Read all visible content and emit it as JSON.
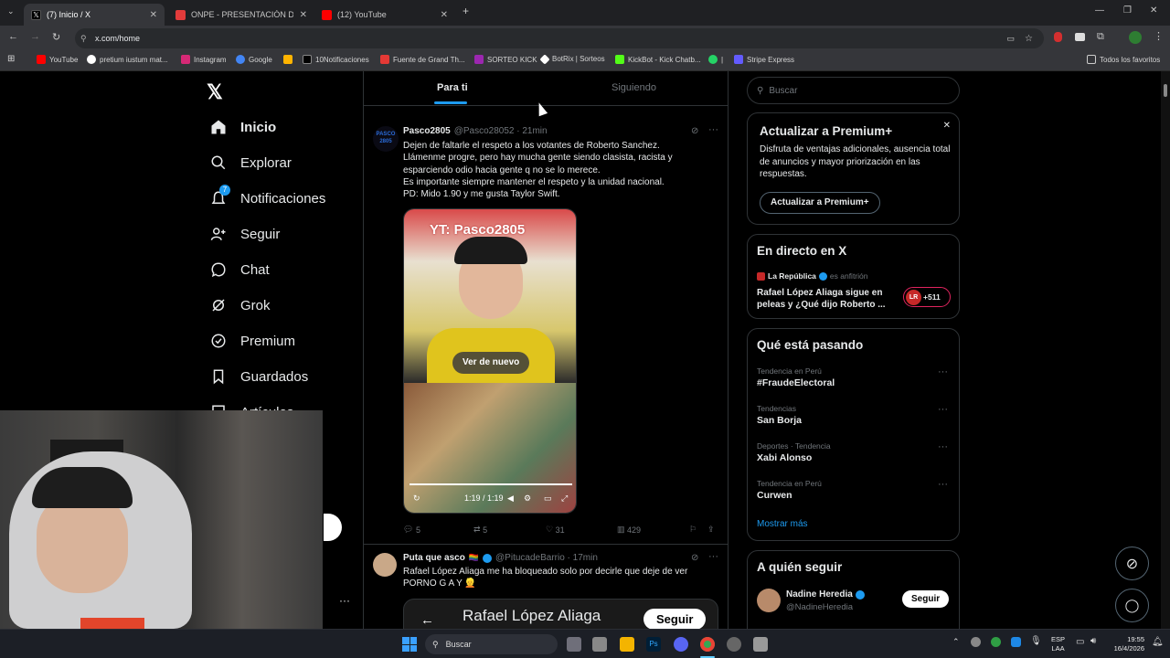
{
  "browser": {
    "tabs": [
      {
        "title": "(7) Inicio / X",
        "color": "#000000"
      },
      {
        "title": "ONPE - PRESENTACIÓN DE RES",
        "color": "#e23b3b"
      },
      {
        "title": "(12) YouTube",
        "color": "#ff0000"
      }
    ],
    "url": "x.com/home",
    "bookmarks": [
      {
        "label": "YouTube",
        "color": "#ff0000"
      },
      {
        "label": "pretium iustum mat...",
        "color": "#ffffff"
      },
      {
        "label": "Instagram",
        "color": "#d62976"
      },
      {
        "label": "Google",
        "color": "#4285f4"
      },
      {
        "label": "",
        "color": "#ffb400"
      },
      {
        "label": "10Notificaciones",
        "color": "#000000"
      },
      {
        "label": "Fuente de Grand Th...",
        "color": "#e53935"
      },
      {
        "label": "SORTEO KICK",
        "color": "#9c27b0"
      },
      {
        "label": "BotRix | Sorteos",
        "color": "#ffffff"
      },
      {
        "label": "KickBot - Kick Chatb...",
        "color": "#53fc18"
      },
      {
        "label": "|",
        "color": "#25d366"
      },
      {
        "label": "Stripe Express",
        "color": "#635bff"
      }
    ],
    "bookmarks_right": "Todos los favoritos"
  },
  "nav": {
    "items": [
      {
        "label": "Inicio",
        "icon": "home-icon"
      },
      {
        "label": "Explorar",
        "icon": "search-icon"
      },
      {
        "label": "Notificaciones",
        "icon": "bell-icon",
        "badge": "7"
      },
      {
        "label": "Seguir",
        "icon": "follow-icon"
      },
      {
        "label": "Chat",
        "icon": "chat-icon"
      },
      {
        "label": "Grok",
        "icon": "grok-icon"
      },
      {
        "label": "Premium",
        "icon": "premium-icon"
      },
      {
        "label": "Guardados",
        "icon": "bookmark-icon"
      },
      {
        "label": "Artículos",
        "icon": "article-icon"
      }
    ]
  },
  "feed": {
    "tabs": [
      "Para ti",
      "Siguiendo"
    ],
    "post1": {
      "name": "Pasco2805",
      "handle": "@Pasco28052 · 21min",
      "avatar_text": "PASCO 2805",
      "text": [
        "Dejen de faltarle el respeto a los votantes de Roberto Sanchez.",
        "Llámenme progre, pero hay mucha gente siendo clasista, racista y",
        "esparciendo odio hacia gente q no se lo merece.",
        "Es importante siempre mantener el respeto y la unidad  nacional.",
        "PD: Mido 1.90 y me gusta Taylor Swift."
      ],
      "video_overlay": "YT: Pasco2805",
      "replay_label": "Ver de nuevo",
      "time": "1:19 / 1:19",
      "replies": "5",
      "reposts": "5",
      "likes": "31",
      "views": "429"
    },
    "post2": {
      "name": "Puta que asco",
      "handle": "@PitucadeBarrio · 17min",
      "text": "Rafael López Aliaga me ha bloqueado solo por decirle que deje de ver PORNO G A Y 👱",
      "card_title": "Rafael López Aliaga",
      "card_button": "Seguir"
    }
  },
  "sidebar": {
    "search_placeholder": "Buscar",
    "premium": {
      "title": "Actualizar a Premium+",
      "text": "Disfruta de ventajas adicionales, ausencia total de anuncios y mayor priorización en las respuestas.",
      "button": "Actualizar a Premium+"
    },
    "live": {
      "title": "En directo en X",
      "source": "La República",
      "host": "es anfitrión",
      "headline": "Rafael López Aliaga sigue en peleas y ¿Qué dijo Roberto ...",
      "count": "+511",
      "logo": "LR"
    },
    "trends": {
      "title": "Qué está pasando",
      "items": [
        {
          "category": "Tendencia en Perú",
          "name": "#FraudeElectoral"
        },
        {
          "category": "Tendencias",
          "name": "San Borja"
        },
        {
          "category": "Deportes · Tendencia",
          "name": "Xabi Alonso"
        },
        {
          "category": "Tendencia en Perú",
          "name": "Curwen"
        }
      ],
      "more": "Mostrar más"
    },
    "follow": {
      "title": "A quién seguir",
      "name": "Nadine Heredia",
      "handle": "@NadineHeredia",
      "button": "Seguir"
    }
  },
  "taskbar": {
    "search": "Buscar",
    "lang": "ESP",
    "lang2": "LAA",
    "time": "19:55",
    "date": "16/4/2026"
  }
}
